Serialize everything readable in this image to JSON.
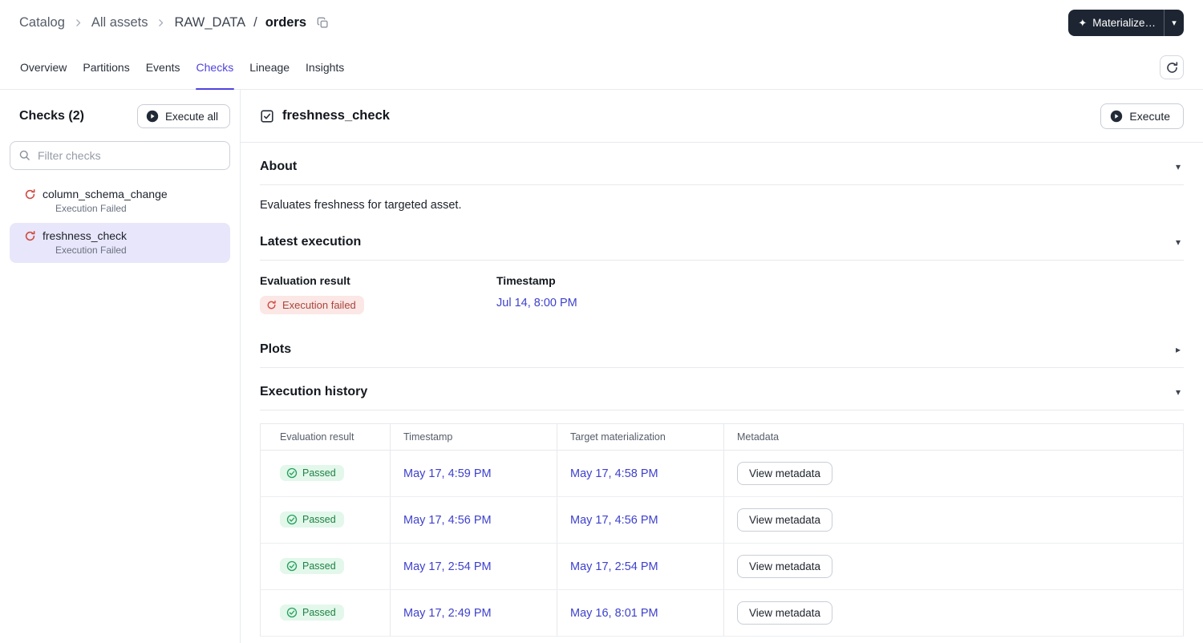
{
  "colors": {
    "accent": "#4F43DD",
    "link": "#3E41CC",
    "danger_text": "#A8453E",
    "danger_bg": "#FBE7E5",
    "success_text": "#1E8244",
    "success_bg": "#E3F7EB",
    "dark_button_bg": "#1D2532",
    "selected_item_bg": "#E8E6FA"
  },
  "glyphs": {
    "caret_down": "▾",
    "caret_right": "▸",
    "sparkle": "✦"
  },
  "breadcrumb": {
    "catalog": "Catalog",
    "all_assets": "All assets",
    "group": "RAW_DATA",
    "slash": "/",
    "asset": "orders"
  },
  "topbar": {
    "materialize_label": "Materialize…"
  },
  "tabs": {
    "items": [
      {
        "label": "Overview",
        "active": false
      },
      {
        "label": "Partitions",
        "active": false
      },
      {
        "label": "Events",
        "active": false
      },
      {
        "label": "Checks",
        "active": true
      },
      {
        "label": "Lineage",
        "active": false
      },
      {
        "label": "Insights",
        "active": false
      }
    ]
  },
  "sidebar": {
    "title": "Checks (2)",
    "execute_all_label": "Execute all",
    "filter_placeholder": "Filter checks",
    "items": [
      {
        "name": "column_schema_change",
        "status": "Execution Failed",
        "selected": false
      },
      {
        "name": "freshness_check",
        "status": "Execution Failed",
        "selected": true
      }
    ]
  },
  "main": {
    "title": "freshness_check",
    "execute_label": "Execute",
    "about": {
      "title": "About",
      "description": "Evaluates freshness for targeted asset."
    },
    "latest": {
      "title": "Latest execution",
      "eval_label": "Evaluation result",
      "timestamp_label": "Timestamp",
      "result_badge": "Execution failed",
      "timestamp_value": "Jul 14, 8:00 PM"
    },
    "plots": {
      "title": "Plots"
    },
    "history": {
      "title": "Execution history",
      "columns": [
        "Evaluation result",
        "Timestamp",
        "Target materialization",
        "Metadata"
      ],
      "rows": [
        {
          "result": "Passed",
          "timestamp": "May 17, 4:59 PM",
          "target": "May 17, 4:58 PM",
          "action": "View metadata"
        },
        {
          "result": "Passed",
          "timestamp": "May 17, 4:56 PM",
          "target": "May 17, 4:56 PM",
          "action": "View metadata"
        },
        {
          "result": "Passed",
          "timestamp": "May 17, 2:54 PM",
          "target": "May 17, 2:54 PM",
          "action": "View metadata"
        },
        {
          "result": "Passed",
          "timestamp": "May 17, 2:49 PM",
          "target": "May 16, 8:01 PM",
          "action": "View metadata"
        }
      ]
    }
  }
}
